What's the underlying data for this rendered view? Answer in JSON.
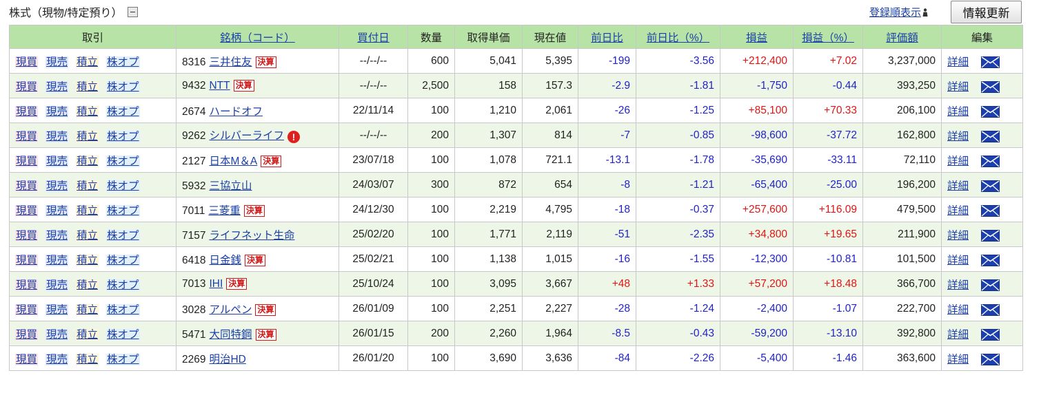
{
  "section": {
    "title": "株式（現物/特定預り）",
    "sort_label": "登録順表示",
    "refresh_label": "情報更新"
  },
  "table": {
    "headers": {
      "trade": "取引",
      "name": "銘柄（コード）",
      "buy_date": "買付日",
      "quantity": "数量",
      "cost": "取得単価",
      "price": "現在値",
      "change": "前日比",
      "change_pct": "前日比（%）",
      "pl": "損益",
      "pl_pct": "損益（%）",
      "value": "評価額",
      "edit": "編集"
    },
    "trade_links": {
      "buy": "現買",
      "sell": "現売",
      "accum": "積立",
      "option": "株オプ"
    },
    "badge_label": "決算",
    "warn_label": "!",
    "detail_label": "詳細",
    "rows": [
      {
        "code": "8316",
        "name": "三井住友",
        "badge": true,
        "warn": false,
        "buy_date": "--/--/--",
        "quantity": "600",
        "cost": "5,041",
        "price": "5,395",
        "change": "-199",
        "change_pct": "-3.56",
        "pl": "+212,400",
        "pl_pct": "+7.02",
        "value": "3,237,000"
      },
      {
        "code": "9432",
        "name": "NTT",
        "badge": true,
        "warn": false,
        "buy_date": "--/--/--",
        "quantity": "2,500",
        "cost": "158",
        "price": "157.3",
        "change": "-2.9",
        "change_pct": "-1.81",
        "pl": "-1,750",
        "pl_pct": "-0.44",
        "value": "393,250"
      },
      {
        "code": "2674",
        "name": "ハードオフ",
        "badge": false,
        "warn": false,
        "buy_date": "22/11/14",
        "quantity": "100",
        "cost": "1,210",
        "price": "2,061",
        "change": "-26",
        "change_pct": "-1.25",
        "pl": "+85,100",
        "pl_pct": "+70.33",
        "value": "206,100"
      },
      {
        "code": "9262",
        "name": "シルバーライフ",
        "badge": false,
        "warn": true,
        "buy_date": "--/--/--",
        "quantity": "200",
        "cost": "1,307",
        "price": "814",
        "change": "-7",
        "change_pct": "-0.85",
        "pl": "-98,600",
        "pl_pct": "-37.72",
        "value": "162,800"
      },
      {
        "code": "2127",
        "name": "日本M＆A",
        "badge": true,
        "warn": false,
        "buy_date": "23/07/18",
        "quantity": "100",
        "cost": "1,078",
        "price": "721.1",
        "change": "-13.1",
        "change_pct": "-1.78",
        "pl": "-35,690",
        "pl_pct": "-33.11",
        "value": "72,110"
      },
      {
        "code": "5932",
        "name": "三協立山",
        "badge": false,
        "warn": false,
        "buy_date": "24/03/07",
        "quantity": "300",
        "cost": "872",
        "price": "654",
        "change": "-8",
        "change_pct": "-1.21",
        "pl": "-65,400",
        "pl_pct": "-25.00",
        "value": "196,200"
      },
      {
        "code": "7011",
        "name": "三菱重",
        "badge": true,
        "warn": false,
        "buy_date": "24/12/30",
        "quantity": "100",
        "cost": "2,219",
        "price": "4,795",
        "change": "-18",
        "change_pct": "-0.37",
        "pl": "+257,600",
        "pl_pct": "+116.09",
        "value": "479,500"
      },
      {
        "code": "7157",
        "name": "ライフネット生命",
        "badge": false,
        "warn": false,
        "buy_date": "25/02/20",
        "quantity": "100",
        "cost": "1,771",
        "price": "2,119",
        "change": "-51",
        "change_pct": "-2.35",
        "pl": "+34,800",
        "pl_pct": "+19.65",
        "value": "211,900"
      },
      {
        "code": "6418",
        "name": "日金銭",
        "badge": true,
        "warn": false,
        "buy_date": "25/02/21",
        "quantity": "100",
        "cost": "1,138",
        "price": "1,015",
        "change": "-16",
        "change_pct": "-1.55",
        "pl": "-12,300",
        "pl_pct": "-10.81",
        "value": "101,500"
      },
      {
        "code": "7013",
        "name": "IHI",
        "badge": true,
        "warn": false,
        "buy_date": "25/10/24",
        "quantity": "100",
        "cost": "3,095",
        "price": "3,667",
        "change": "+48",
        "change_pct": "+1.33",
        "pl": "+57,200",
        "pl_pct": "+18.48",
        "value": "366,700"
      },
      {
        "code": "3028",
        "name": "アルペン",
        "badge": true,
        "warn": false,
        "buy_date": "26/01/09",
        "quantity": "100",
        "cost": "2,251",
        "price": "2,227",
        "change": "-28",
        "change_pct": "-1.24",
        "pl": "-2,400",
        "pl_pct": "-1.07",
        "value": "222,700"
      },
      {
        "code": "5471",
        "name": "大同特鋼",
        "badge": true,
        "warn": false,
        "buy_date": "26/01/15",
        "quantity": "200",
        "cost": "2,260",
        "price": "1,964",
        "change": "-8.5",
        "change_pct": "-0.43",
        "pl": "-59,200",
        "pl_pct": "-13.10",
        "value": "392,800"
      },
      {
        "code": "2269",
        "name": "明治HD",
        "badge": false,
        "warn": false,
        "buy_date": "26/01/20",
        "quantity": "100",
        "cost": "3,690",
        "price": "3,636",
        "change": "-84",
        "change_pct": "-2.26",
        "pl": "-5,400",
        "pl_pct": "-1.46",
        "value": "363,600"
      }
    ]
  },
  "colors": {
    "header_bg": "#b8e3a7",
    "row_alt_bg": "#eef7e7",
    "link": "#1a3fa8",
    "negative": "#1f22c8",
    "positive": "#e01414",
    "badge": "#d01818"
  },
  "icons": {
    "collapse": "minus-box-icon",
    "sort": "person-icon",
    "warning": "exclamation-circle-icon",
    "mail": "envelope-icon"
  }
}
